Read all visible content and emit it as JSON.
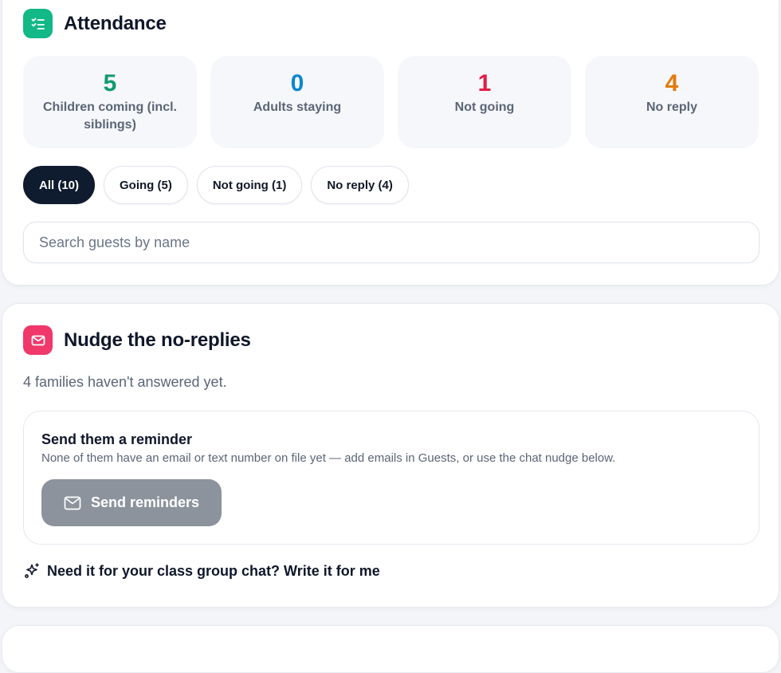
{
  "attendance": {
    "title": "Attendance",
    "stats": [
      {
        "value": "5",
        "label": "Children coming (incl. siblings)",
        "color": "#0f9a6e"
      },
      {
        "value": "0",
        "label": "Adults staying",
        "color": "#0b86d1"
      },
      {
        "value": "1",
        "label": "Not going",
        "color": "#e11d48"
      },
      {
        "value": "4",
        "label": "No reply",
        "color": "#e47a0c"
      }
    ],
    "filters": [
      {
        "label": "All (10)",
        "active": true
      },
      {
        "label": "Going (5)",
        "active": false
      },
      {
        "label": "Not going (1)",
        "active": false
      },
      {
        "label": "No reply (4)",
        "active": false
      }
    ],
    "search": {
      "placeholder": "Search guests by name",
      "value": ""
    }
  },
  "nudge": {
    "title": "Nudge the no-replies",
    "subtitle": "4 families haven't answered yet.",
    "reminder": {
      "title": "Send them a reminder",
      "description": "None of them have an email or text number on file yet — add emails in Guests, or use the chat nudge below.",
      "button_label": "Send reminders"
    },
    "write_link": "Need it for your class group chat? Write it for me"
  },
  "icons": {
    "attendance_icon": "checklist-icon",
    "nudge_icon": "mail-icon",
    "send_icon": "mail-icon",
    "write_icon": "sparkles-icon"
  },
  "colors": {
    "attendance_accent": "#12b886",
    "nudge_accent": "#f0386b",
    "active_chip": "#0f1b2e",
    "disabled_button": "#8d939c"
  }
}
